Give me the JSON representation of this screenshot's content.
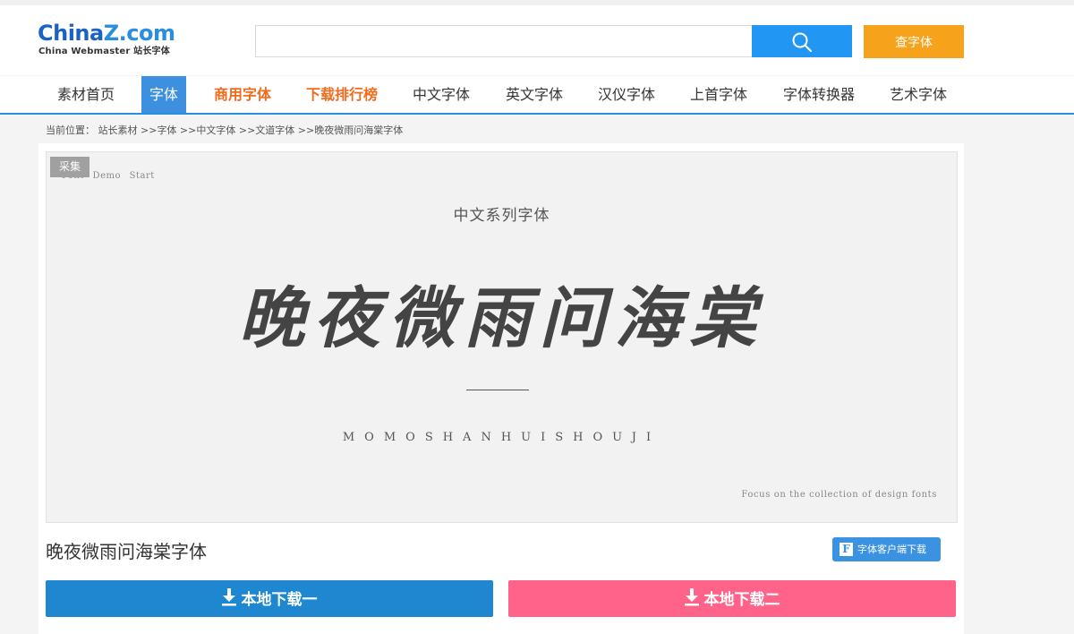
{
  "header": {
    "logo": {
      "part1": "China",
      "part2": "Z",
      "part3": ".com",
      "subtitle": "China Webmaster 站长字体"
    },
    "search": {
      "value": "",
      "placeholder": ""
    },
    "font_button_label": "查字体"
  },
  "nav": {
    "items": [
      {
        "label": "素材首页",
        "state": "normal"
      },
      {
        "label": "字体",
        "state": "active"
      },
      {
        "label": "商用字体",
        "state": "highlight"
      },
      {
        "label": "下载排行榜",
        "state": "highlight"
      },
      {
        "label": "中文字体",
        "state": "normal"
      },
      {
        "label": "英文字体",
        "state": "normal"
      },
      {
        "label": "汉仪字体",
        "state": "normal"
      },
      {
        "label": "上首字体",
        "state": "normal"
      },
      {
        "label": "字体转换器",
        "state": "normal"
      },
      {
        "label": "艺术字体",
        "state": "normal"
      }
    ]
  },
  "breadcrumb": {
    "prefix": "当前位置：",
    "items": [
      "站长素材",
      "字体",
      "中文字体",
      "文道字体",
      "晚夜微雨问海棠字体"
    ],
    "separator": " >>"
  },
  "preview": {
    "tag": "采集",
    "demo_start": "Font Demo Start",
    "series_title": "中文系列字体",
    "font_sample": "晚夜微雨问海棠",
    "pinyin": "MOMOSHANHUISHOUJI",
    "focus_text": "Focus on the collection of design fonts"
  },
  "font_title": "晚夜微雨问海棠字体",
  "client_download": {
    "icon_letter": "F",
    "label": "字体客户端下载"
  },
  "downloads": {
    "one": "本地下载一",
    "two": "本地下载二"
  },
  "colors": {
    "brand_blue": "#2196f3",
    "orange": "#f7a21b",
    "nav_active": "#3d8fdf",
    "nav_highlight": "#f26b1d",
    "download_one": "#1e87d0",
    "download_two": "#ff6389"
  }
}
